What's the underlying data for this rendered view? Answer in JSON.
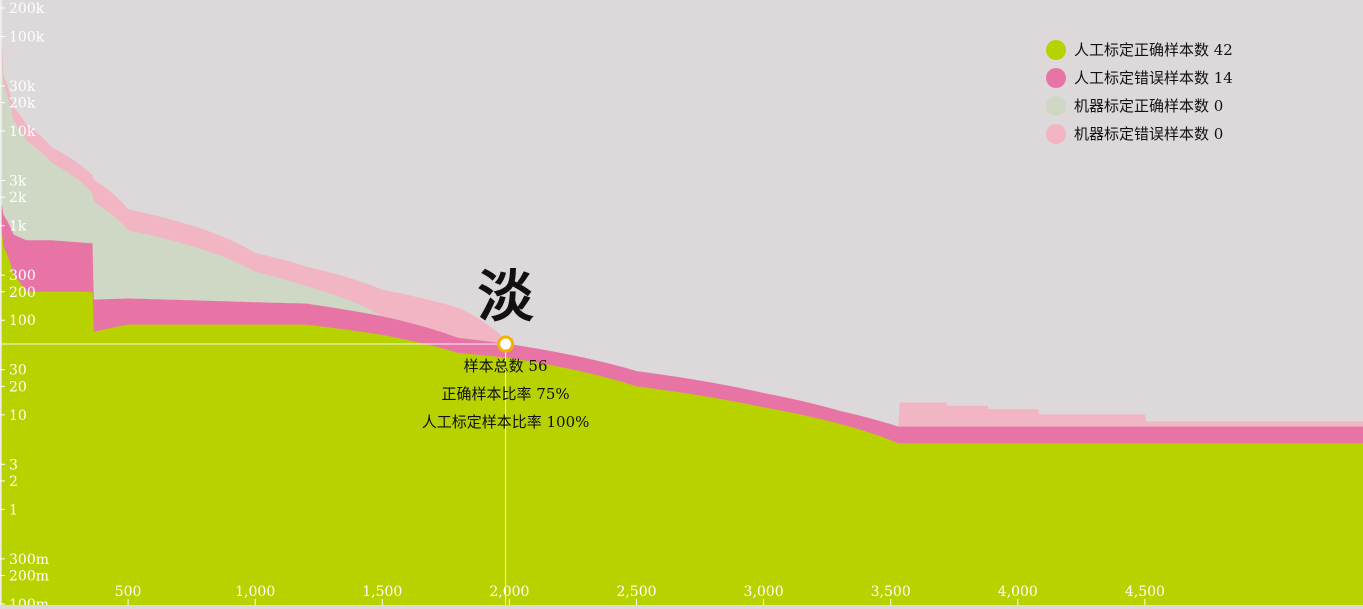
{
  "chart_data": {
    "type": "area",
    "title": "",
    "xlabel": "",
    "ylabel": "",
    "x_range": [
      0,
      5400
    ],
    "x_ticks": [
      500,
      1000,
      1500,
      2000,
      2500,
      3000,
      3500,
      4000,
      4500
    ],
    "x_tick_labels": [
      "500",
      "1,000",
      "1,500",
      "2,000",
      "2,500",
      "3,000",
      "3,500",
      "4,000",
      "4,500"
    ],
    "y_scale": "log",
    "y_range": [
      0.1,
      200000
    ],
    "y_ticks": [
      0.1,
      0.2,
      0.3,
      1,
      2,
      3,
      10,
      20,
      30,
      100,
      200,
      300,
      1000,
      2000,
      3000,
      10000,
      20000,
      30000,
      100000,
      200000
    ],
    "y_tick_labels": [
      "100m",
      "200m",
      "300m",
      "1",
      "2",
      "3",
      "10",
      "20",
      "30",
      "100",
      "200",
      "300",
      "1k",
      "2k",
      "3k",
      "10k",
      "20k",
      "30k",
      "100k",
      "200k"
    ],
    "grid": false,
    "legend_position": "top-right",
    "series": [
      {
        "name": "人工标定正确样本数",
        "legend_value": "42",
        "color": "#b8d200",
        "x": [
          0,
          10,
          50,
          100,
          200,
          360,
          361,
          500,
          1000,
          1200,
          1500,
          1800,
          2000,
          2500,
          3000,
          3300,
          3530
        ],
        "y": [
          1000,
          600,
          300,
          200,
          200,
          200,
          75,
          90,
          90,
          90,
          70,
          45,
          40,
          20,
          12,
          8,
          5
        ]
      },
      {
        "name": "人工标定错误样本数",
        "legend_value": "14",
        "color": "#e874a6",
        "x": [
          0,
          10,
          50,
          100,
          200,
          360,
          361,
          500,
          1000,
          1200,
          1500,
          1800,
          2000,
          2500,
          3000,
          3300,
          3530
        ],
        "y": [
          800,
          700,
          500,
          500,
          500,
          450,
          90,
          80,
          65,
          60,
          40,
          20,
          16,
          9,
          5,
          3,
          2.5
        ]
      },
      {
        "name": "机器标定正确样本数",
        "legend_value": "0",
        "color": "#cfd8c4",
        "x": [
          0,
          10,
          50,
          100,
          200,
          360,
          361,
          500,
          1000,
          1200,
          1500,
          1800,
          2000,
          2500,
          3000,
          3300,
          3530
        ],
        "y": [
          70000,
          29000,
          12000,
          7200,
          3900,
          1550,
          1635,
          720,
          170,
          80,
          0,
          0,
          0,
          0,
          0,
          0,
          0
        ]
      },
      {
        "name": "机器标定错误样本数",
        "legend_value": "0",
        "color": "#f2b5c4",
        "x": [
          0,
          10,
          50,
          100,
          200,
          360,
          361,
          500,
          1000,
          1200,
          1500,
          1800,
          2000,
          2500,
          3000,
          3300,
          3530,
          3531,
          3720,
          3721,
          3880,
          3881,
          4080,
          4081,
          4500,
          4501,
          5400
        ],
        "y": [
          30000,
          8000,
          5000,
          3800,
          2100,
          1200,
          1300,
          600,
          190,
          140,
          100,
          70,
          0,
          0,
          0,
          0,
          0,
          6,
          6,
          5,
          5,
          4,
          4,
          2.6,
          2.6,
          1,
          1
        ]
      }
    ],
    "hover": {
      "x": 1985,
      "y": 56,
      "character": "淡",
      "lines": [
        "样本总数 56",
        "正确样本比率 75%",
        "人工标定样本比率 100%"
      ]
    }
  }
}
